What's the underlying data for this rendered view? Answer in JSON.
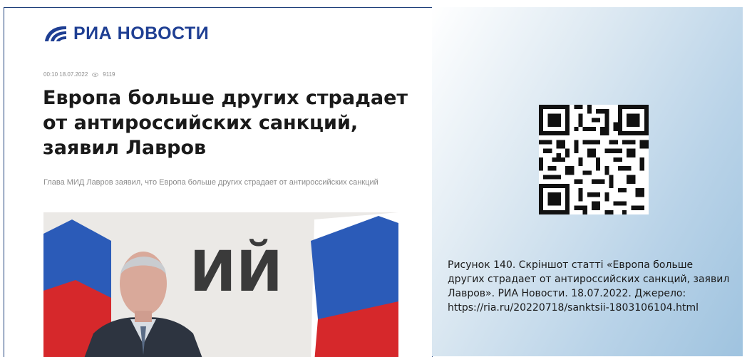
{
  "article": {
    "brand": "РИА НОВОСТИ",
    "meta_datetime": "00:10 18.07.2022",
    "meta_views": "9119",
    "headline": "Европа больше других страдает от антироссийских санкций, заявил Лавров",
    "lead": "Глава МИД Лавров заявил, что Европа больше других страдает от антироссийских санкций",
    "photo_backdrop_text": "ИЙ",
    "icons": [
      "ria-logo-icon",
      "eye-icon"
    ]
  },
  "figure": {
    "caption": "Рисунок 140. Скріншот статті «Европа больше других страдает от антироссийских санкций, заявил Лавров». РИА Новости. 18.07.2022. Джерело: https://ria.ru/20220718/sanktsii-1803106104.html",
    "qr_icon": "qr-code-icon"
  },
  "colors": {
    "brand_blue": "#1f3f93",
    "panel_border": "#1e3f7a",
    "flag_blue": "#2b5bb8",
    "flag_red": "#d6282b"
  }
}
